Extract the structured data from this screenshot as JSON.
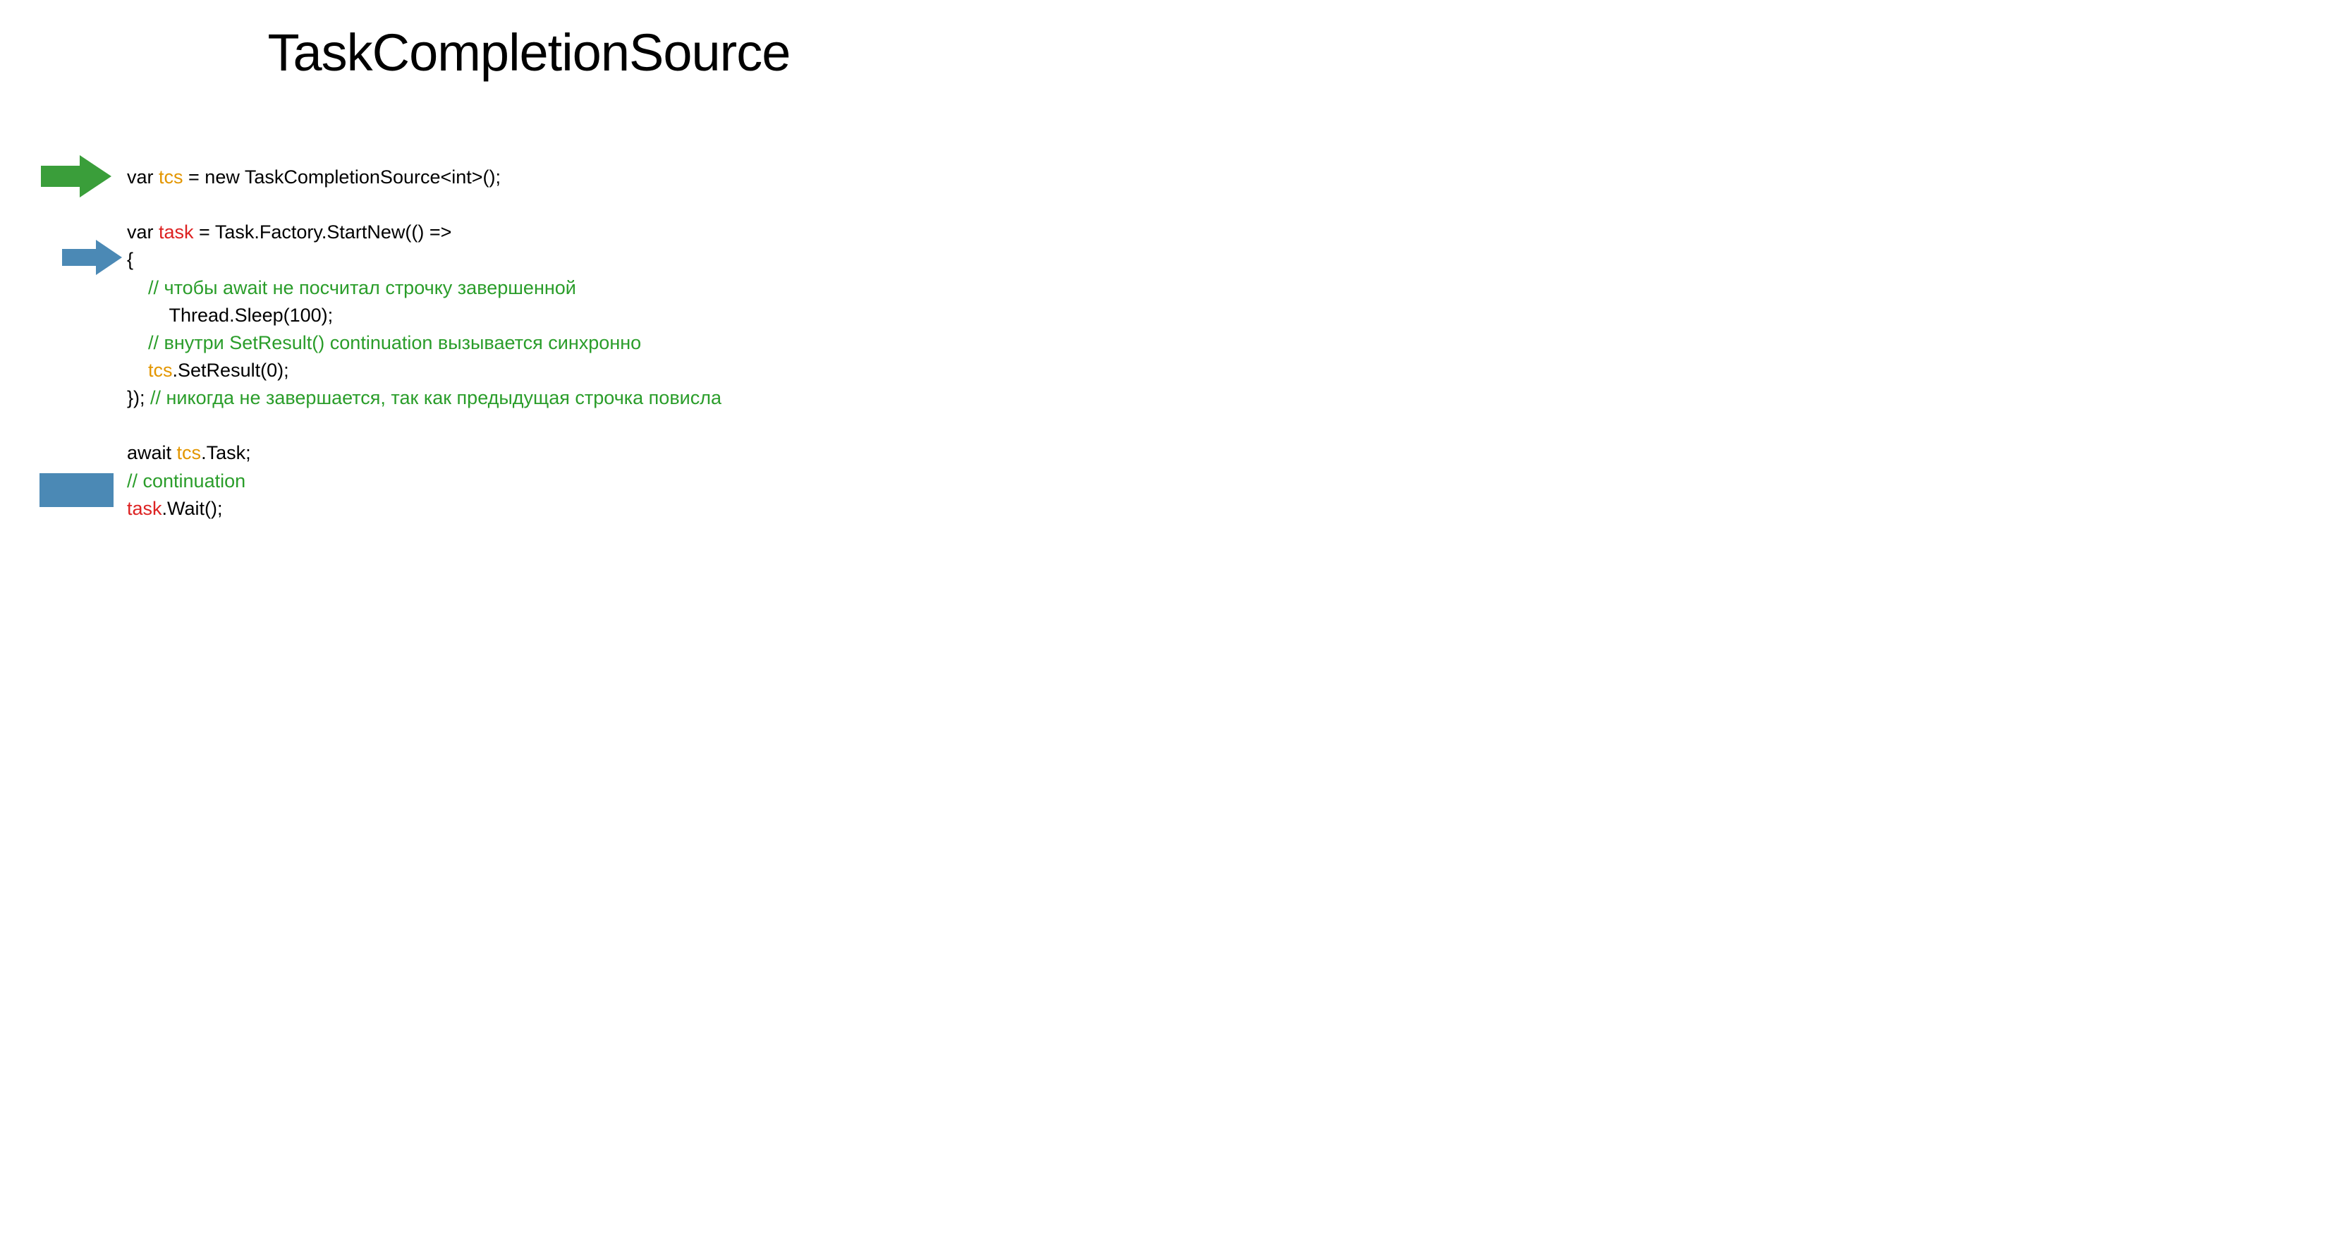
{
  "title": "TaskCompletionSource",
  "code": {
    "l1": {
      "var": "var ",
      "tcs": "tcs",
      "rest": " = new TaskCompletionSource<int>();"
    },
    "l2": {
      "var": "var ",
      "task": "task",
      "rest": " = Task.Factory.StartNew(() =>"
    },
    "l3": "{",
    "l4": {
      "indent": "    ",
      "comment": "// чтобы await не посчитал строчку завершенной"
    },
    "l5": "        Thread.Sleep(100);",
    "l6": {
      "indent": "    ",
      "comment": "// внутри SetResult() continuation вызывается синхронно"
    },
    "l7": {
      "indent": "    ",
      "tcs": "tcs",
      "rest": ".SetResult(0);"
    },
    "l8": {
      "prefix": "}); ",
      "comment": "// никогда не завершается, так как предыдущая строчка повисла"
    },
    "l9": {
      "await": "await ",
      "tcs": "tcs",
      "rest": ".Task;"
    },
    "l10": "// continuation",
    "l11": {
      "task": "task",
      "rest": ".Wait();"
    }
  },
  "colors": {
    "green": "#3a9e3a",
    "blue": "#4b89b5",
    "orange": "#e39600",
    "red": "#d22",
    "commentGreen": "#2a9d2a"
  }
}
